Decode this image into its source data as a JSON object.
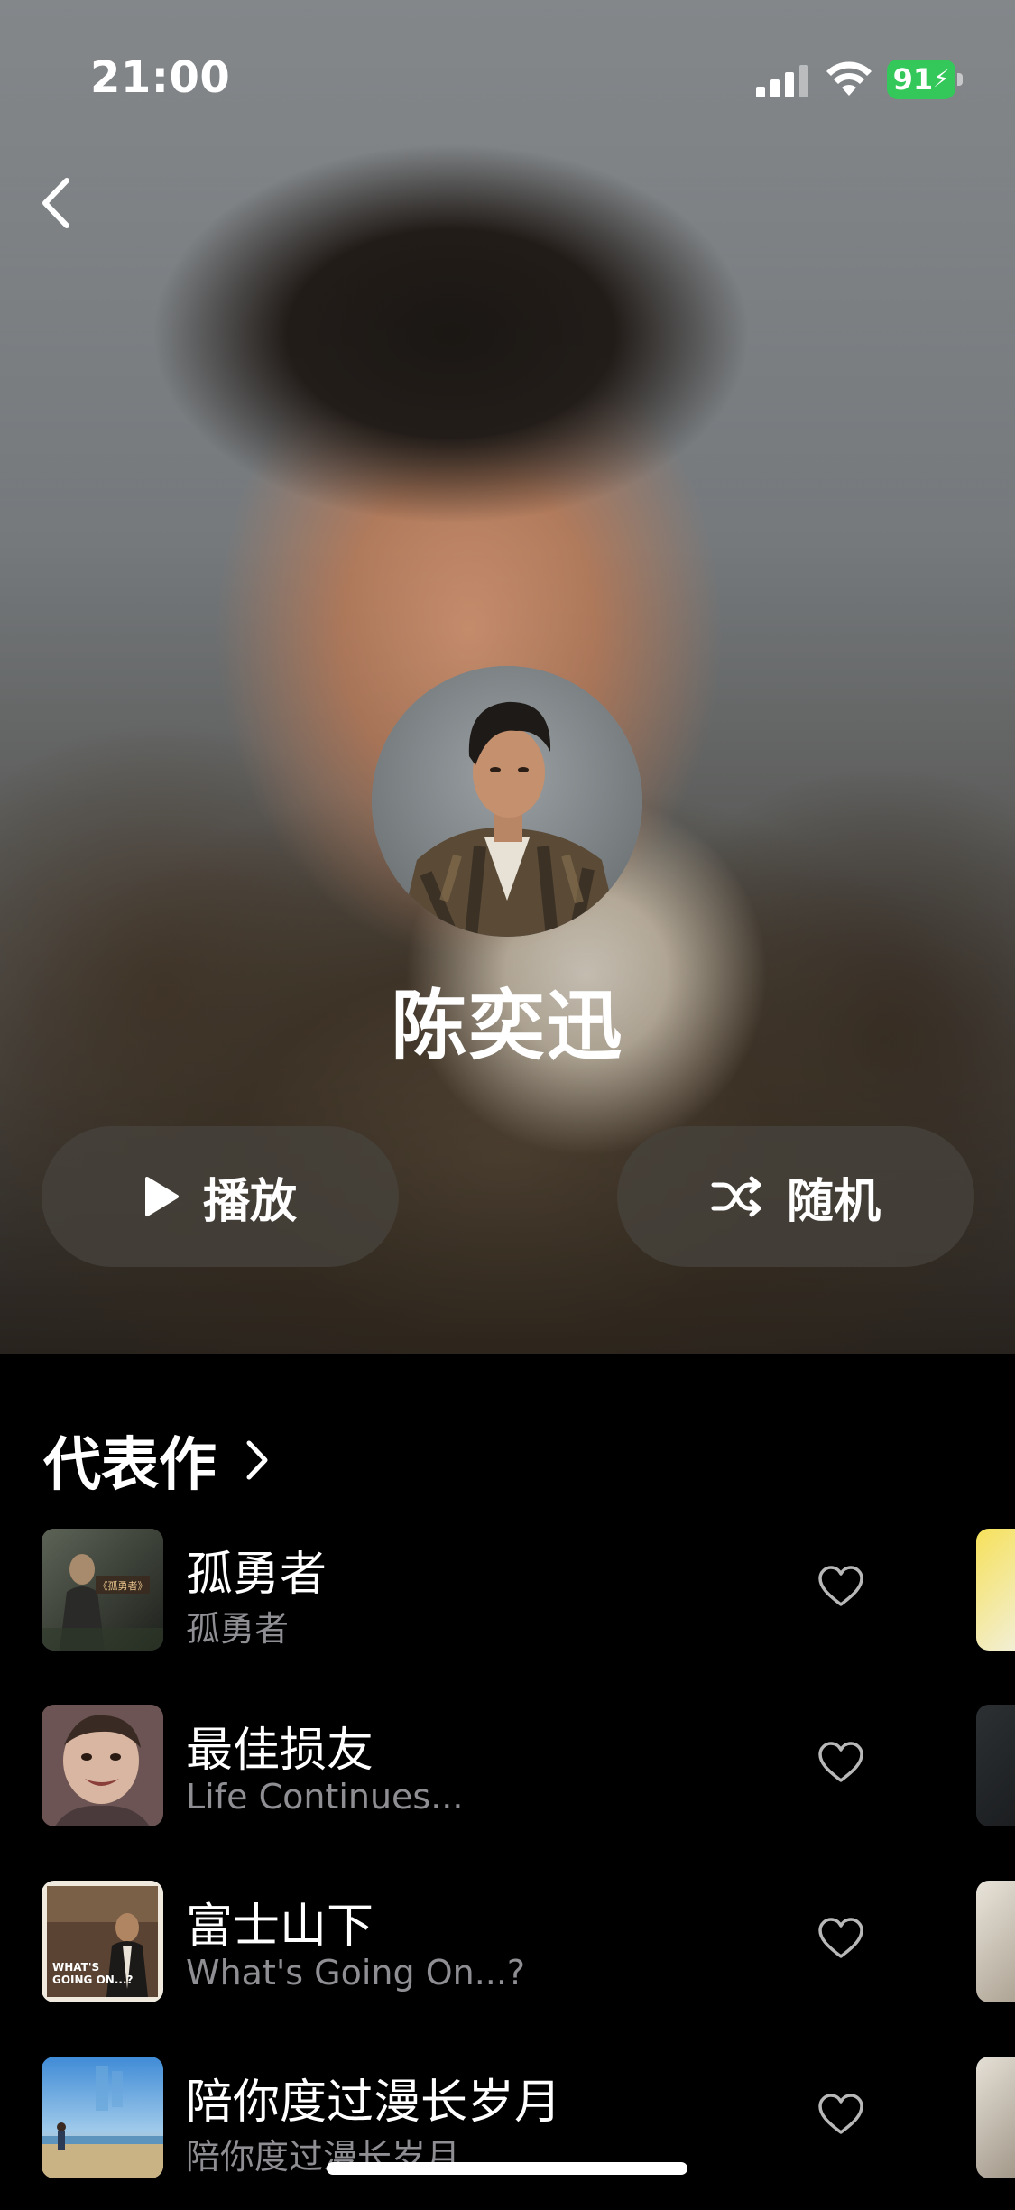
{
  "status_bar": {
    "time": "21:00",
    "battery": "91"
  },
  "artist": {
    "name": "陈奕迅"
  },
  "actions": {
    "play_label": "播放",
    "shuffle_label": "随机"
  },
  "section": {
    "title": "代表作"
  },
  "songs": [
    {
      "title": "孤勇者",
      "subtitle": "孤勇者",
      "cover_text": "《孤勇者》"
    },
    {
      "title": "最佳损友",
      "subtitle": "Life Continues..."
    },
    {
      "title": "富士山下",
      "subtitle": "What's Going On...?",
      "cover_text": "WHAT'S GOING ON...?"
    },
    {
      "title": "陪你度过漫长岁月",
      "subtitle": "陪你度过漫长岁月"
    }
  ],
  "colors": {
    "background": "#000000",
    "battery_green": "#34c759",
    "subtitle_gray": "#8e8e93"
  }
}
